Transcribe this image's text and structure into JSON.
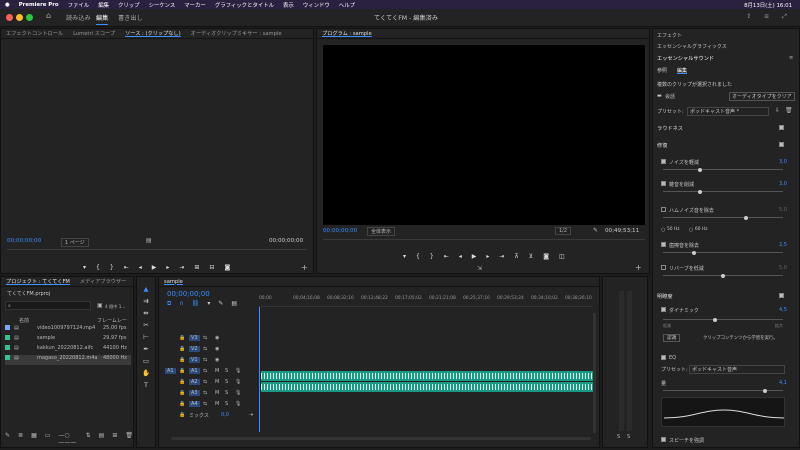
{
  "menubar": {
    "app": "Premiere Pro",
    "items": [
      "ファイル",
      "編集",
      "クリップ",
      "シーケンス",
      "マーカー",
      "グラフィックとタイトル",
      "表示",
      "ウィンドウ",
      "ヘルプ"
    ],
    "clock": "8月13日(土) 16:01"
  },
  "titlebar": {
    "tabs": [
      "読み込み",
      "編集",
      "書き出し"
    ],
    "title": "てくてくFM - 編集済み"
  },
  "source_panel": {
    "tabs": [
      "エフェクトコントロール",
      "Lumetri スコープ",
      "ソース : (クリップなし)",
      "オーディオクリップミキサー : sample"
    ],
    "tc_left": "00;00;00;00",
    "fit": "1 ページ",
    "tc_right": "00;00;00;00"
  },
  "program_panel": {
    "tab": "プログラム : sample",
    "tc_left": "00;00;00;00",
    "fit": "全体表示",
    "quality": "1/2",
    "tc_right": "00;49;53;11"
  },
  "project_panel": {
    "tabs": [
      "プロジェクト : てくてくFM",
      "メディアブラウザー"
    ],
    "file": "てくてくFM.prproj",
    "count": "4 個中 1...",
    "col_name": "名前",
    "col_rate": "フレームレー",
    "items": [
      {
        "name": "video1009797124.mp4",
        "rate": "25,00 fps",
        "color": "#7aa6ff"
      },
      {
        "name": "sample",
        "rate": "29,97 fps",
        "color": "#36c28f"
      },
      {
        "name": "kakkun_20220812.aifc",
        "rate": "44100 Hz",
        "color": "#36c28f"
      },
      {
        "name": "magaso_20220812.m4a",
        "rate": "48000 Hz",
        "color": "#36c28f"
      }
    ]
  },
  "timeline": {
    "tab": "sample",
    "tc": "00;00;00;00",
    "ruler": [
      "00;00",
      "00;04;16;08",
      "00;08;32;16",
      "00;12;48;22",
      "00;17;05;02",
      "00;21;21;08",
      "00;25;37;16",
      "00;29;53;24",
      "00;34;10;02",
      "00;38;26;10"
    ],
    "video_tracks": [
      "V3",
      "V2",
      "V1"
    ],
    "audio_tracks": [
      "A1",
      "A2",
      "A3",
      "A4"
    ],
    "mix": "ミックス",
    "mix_val": "0,0",
    "track_btns": [
      "M",
      "S"
    ]
  },
  "right_panel": {
    "items": [
      "エフェクト",
      "エッセンシャルグラフィックス"
    ],
    "title": "エッセンシャルサウンド",
    "tabs": [
      "参照",
      "編集"
    ],
    "selected": "複数のクリップが選択されました",
    "voice": "会話",
    "clear_btn": "オーディオタイプをクリア",
    "preset_label": "プリセット:",
    "preset": "ポッドキャスト音声 *",
    "loudness": "ラウドネス",
    "repair": "修復",
    "repair_items": [
      {
        "label": "ノイズを軽減",
        "value": "3,0",
        "on": true,
        "pos": 0.3
      },
      {
        "label": "雑音を削減",
        "value": "3,0",
        "on": true,
        "pos": 0.3
      },
      {
        "label": "ハムノイズ音を除去",
        "value": "5,0",
        "on": false,
        "pos": 0.7
      },
      {
        "label": "歯擦音を除去",
        "value": "2,5",
        "on": true,
        "pos": 0.25
      },
      {
        "label": "リバーブを低減",
        "value": "5,0",
        "on": false,
        "pos": 0.5
      }
    ],
    "hz": [
      "50 Hz",
      "60 Hz"
    ],
    "clarity": "明瞭度",
    "dynamic": "ダイナミック",
    "dynamic_val": "4,5",
    "low": "低減",
    "high": "拡大",
    "learn": "認識",
    "learn_note": "クリップコンテンツから学習を実行。",
    "eq": "EQ",
    "eq_preset": "ポッドキャスト音声",
    "amount": "量",
    "amount_val": "4,1",
    "speech": "スピーチを強調"
  }
}
